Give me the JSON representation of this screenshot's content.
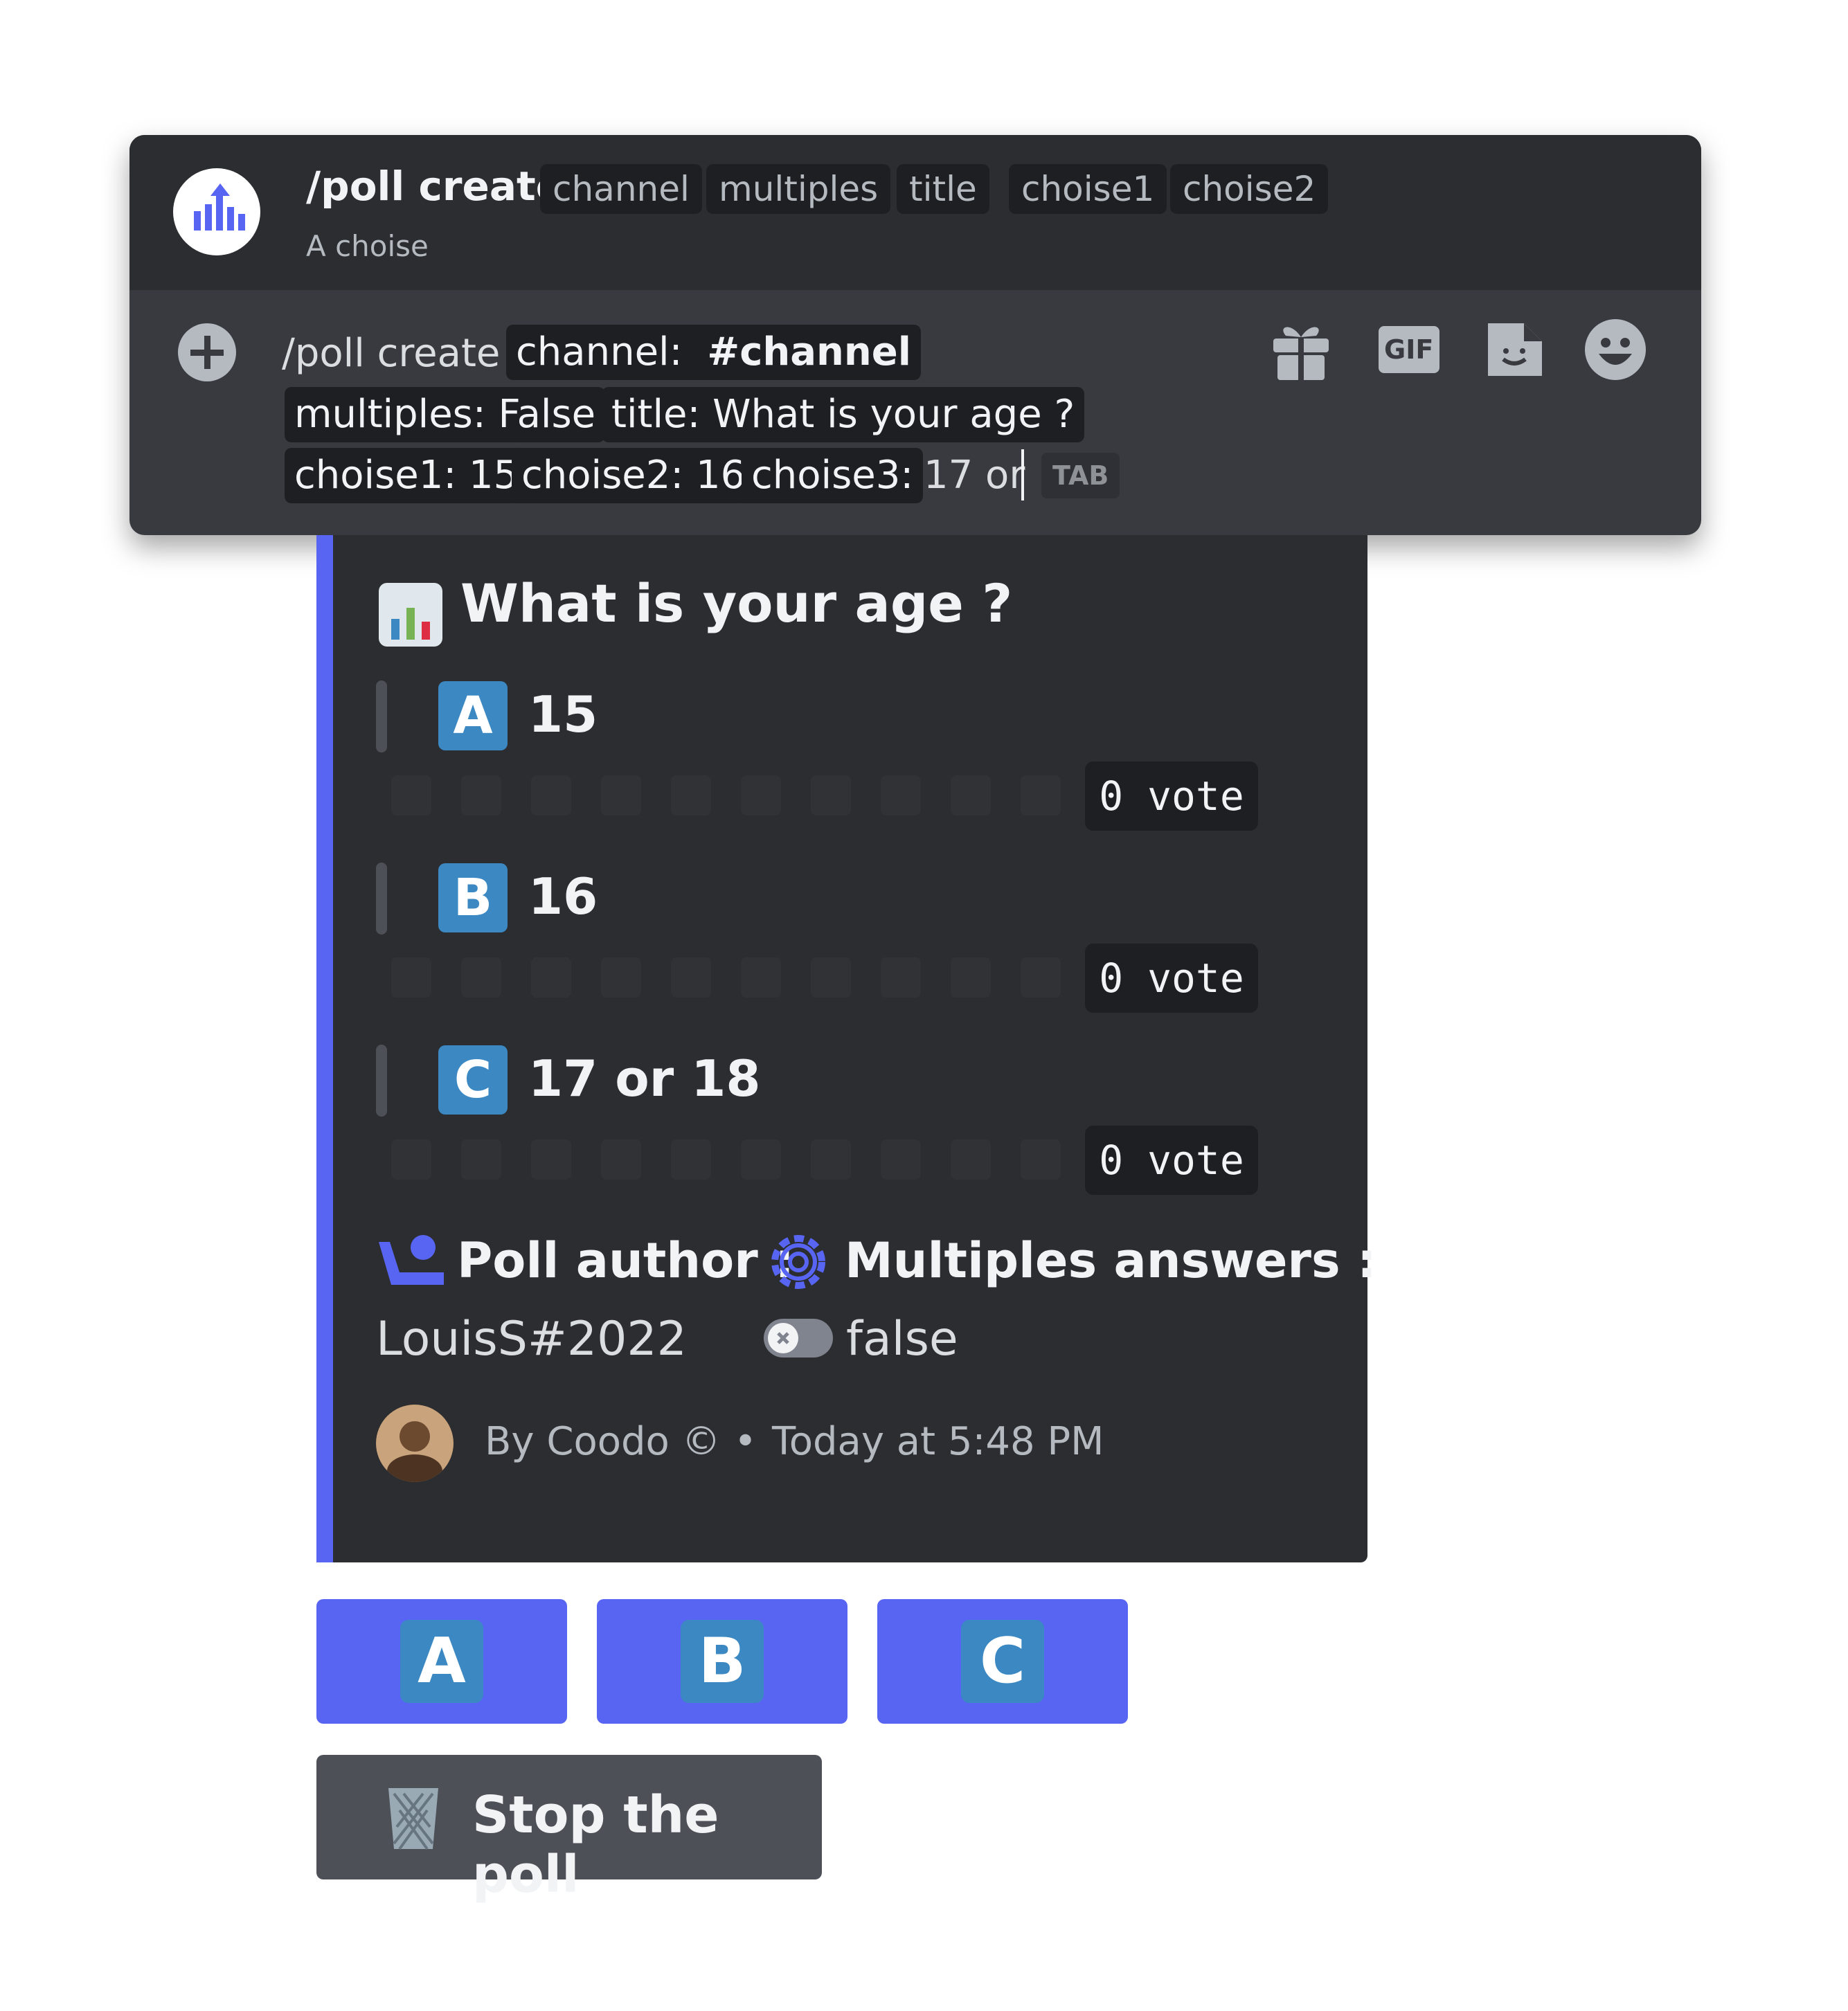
{
  "command_window": {
    "command_name": "/poll create",
    "options": [
      "channel",
      "multiples",
      "title",
      "choise1",
      "choise2"
    ],
    "description": "A choise",
    "input": {
      "prefix": "/poll create",
      "channel_label": "channel:",
      "channel_value": "#channel",
      "multiples": "multiples: False",
      "title": "title: What is your age ?",
      "choise1": "choise1: 15",
      "choise2": "choise2: 16",
      "choise3_label": "choise3:",
      "typed_text": "17 or",
      "tab_hint": "TAB"
    },
    "toolbar_icons": [
      "gift-icon",
      "gif-icon",
      "sticker-icon",
      "emoji-icon"
    ],
    "gif_label": "GIF"
  },
  "embed": {
    "title": "What is your age ?",
    "accent_color": "#5865f2",
    "options": [
      {
        "letter": "A",
        "label": "15",
        "votes": "0 vote",
        "fill_fraction": 0
      },
      {
        "letter": "B",
        "label": "16",
        "votes": "0 vote",
        "fill_fraction": 0
      },
      {
        "letter": "C",
        "label": "17 or 18",
        "votes": "0 vote",
        "fill_fraction": 0
      }
    ],
    "author_field": {
      "name": "Poll author :",
      "value": "LouisS#2022"
    },
    "multiples_field": {
      "name": "Multiples answers :",
      "value": "false",
      "toggle_on": false
    },
    "footer": {
      "by": "By Coodo ©",
      "separator": "•",
      "time": "Today at 5:48 PM"
    }
  },
  "buttons": {
    "vote": [
      "A",
      "B",
      "C"
    ],
    "stop_label": "Stop the poll"
  }
}
